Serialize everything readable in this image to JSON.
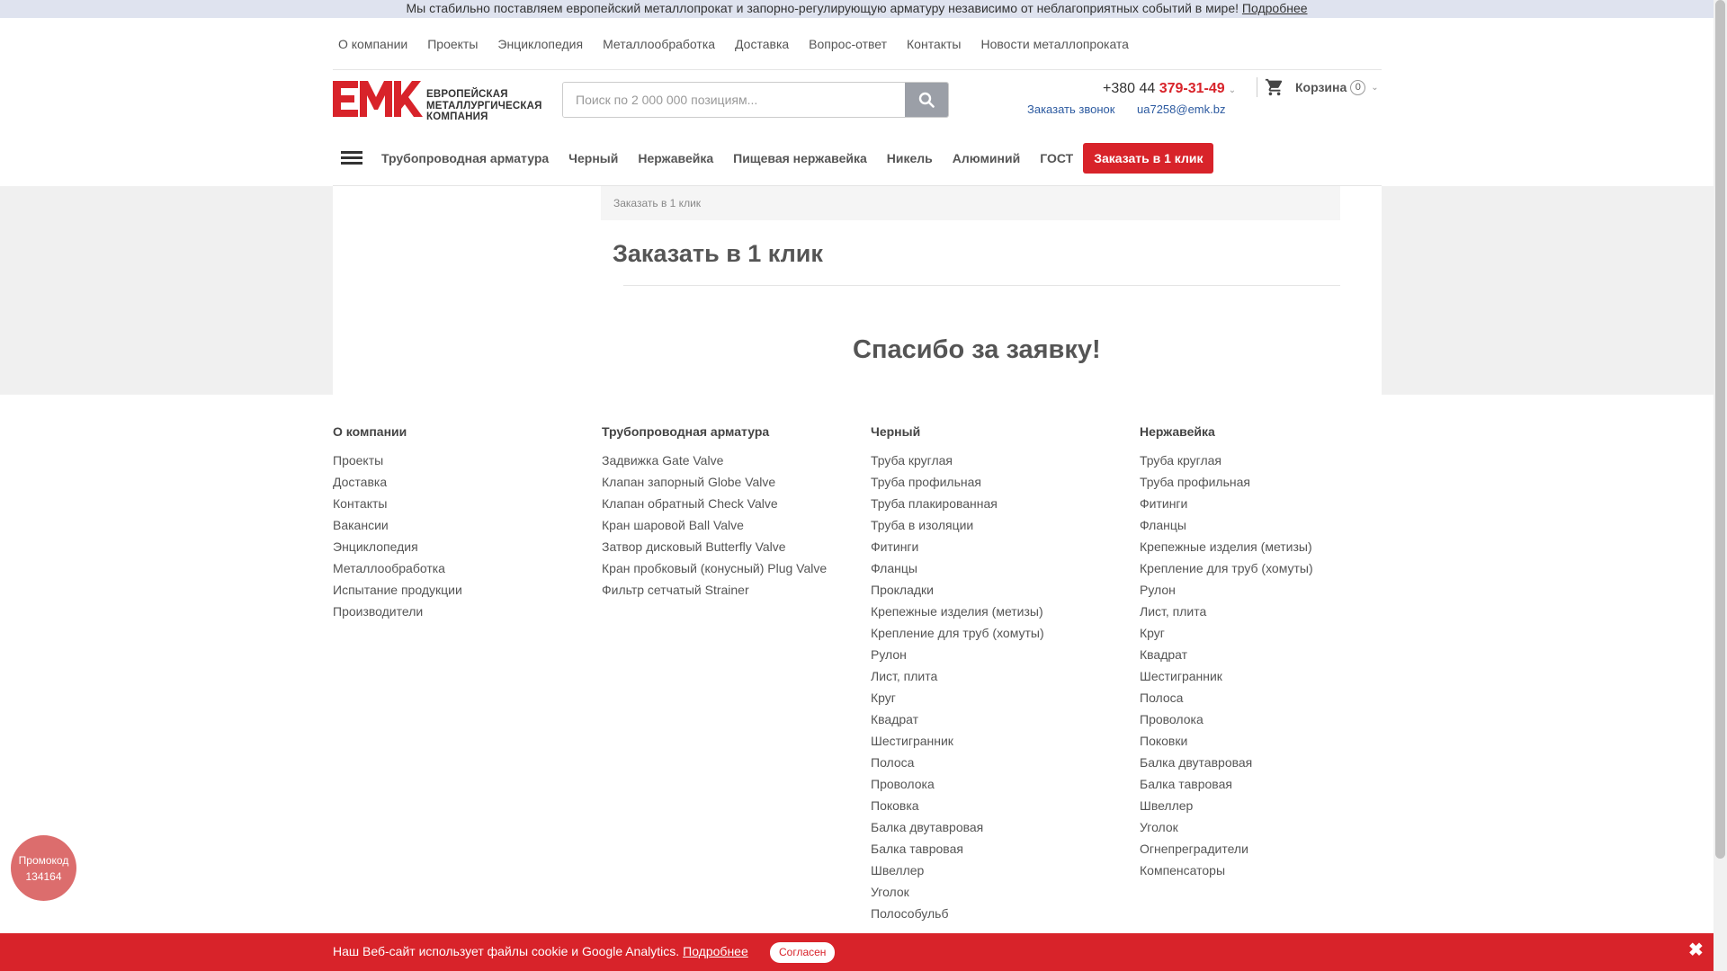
{
  "announcement": {
    "text": "Мы стабильно поставляем европейский металлопрокат и запорно-регулирующую арматуру независимо от неблагоприятных событий в мире!",
    "link": "Подробнее"
  },
  "topnav": [
    "О компании",
    "Проекты",
    "Энциклопедия",
    "Металлообработка",
    "Доставка",
    "Вопрос-ответ",
    "Контакты",
    "Новости металлопроката"
  ],
  "logo": {
    "mark": "EMK",
    "text_line1": "Европейская",
    "text_line2": "Металлургическая",
    "text_line3": "Компания"
  },
  "search": {
    "placeholder": "Поиск по 2 000 000 позициям..."
  },
  "contact": {
    "phone_prefix": "+380 44 ",
    "phone_main": "379-31-49",
    "callback": "Заказать звонок",
    "email": "ua7258@emk.bz"
  },
  "cart": {
    "label": "Корзина",
    "count": "0"
  },
  "catnav": [
    "Трубопроводная арматура",
    "Черный",
    "Нержавейка",
    "Пищевая нержавейка",
    "Никель",
    "Алюминий",
    "ГОСТ"
  ],
  "order_button": "Заказать в 1 клик",
  "breadcrumb": "Заказать в 1 клик",
  "page_title": "Заказать в 1 клик",
  "thanks": "Спасибо за заявку!",
  "footer": [
    {
      "heading": "О компании",
      "links": [
        "Проекты",
        "Доставка",
        "Контакты",
        "Вакансии",
        "Энциклопедия",
        "Металлообработка",
        "Испытание продукции",
        "Производители"
      ]
    },
    {
      "heading": "Трубопроводная арматура",
      "links": [
        "Задвижка Gate Valve",
        "Клапан запорный Globe Valve",
        "Клапан обратный Check Valve",
        "Кран шаровой Ball Valve",
        "Затвор дисковый Butterfly Valve",
        "Кран пробковый (конусный) Plug Valve",
        "Фильтр сетчатый Strainer"
      ]
    },
    {
      "heading": "Черный",
      "links": [
        "Труба круглая",
        "Труба профильная",
        "Труба плакированная",
        "Труба в изоляции",
        "Фитинги",
        "Фланцы",
        "Прокладки",
        "Крепежные изделия (метизы)",
        "Крепление для труб (хомуты)",
        "Рулон",
        "Лист, плита",
        "Круг",
        "Квадрат",
        "Шестигранник",
        "Полоса",
        "Проволока",
        "Поковка",
        "Балка двутавровая",
        "Балка тавровая",
        "Швеллер",
        "Уголок",
        "Полособульб"
      ]
    },
    {
      "heading": "Нержавейка",
      "links": [
        "Труба круглая",
        "Труба профильная",
        "Фитинги",
        "Фланцы",
        "Крепежные изделия (метизы)",
        "Крепление для труб (хомуты)",
        "Рулон",
        "Лист, плита",
        "Круг",
        "Квадрат",
        "Шестигранник",
        "Полоса",
        "Проволока",
        "Поковки",
        "Балка двутавровая",
        "Балка тавровая",
        "Швеллер",
        "Уголок",
        "Огнепреградители",
        "Компенсаторы"
      ]
    }
  ],
  "promo": {
    "line1": "Промокод",
    "line2": "134164"
  },
  "cookie": {
    "text": "Наш Веб-сайт использует файлы cookie и Google Analytics.",
    "link": "Подробнее",
    "accept": "Согласен",
    "close": "✖"
  },
  "colors": {
    "brand_red": "#d8232a",
    "link_blue": "#2c5aa0",
    "topbar": "#dfe3ef"
  }
}
